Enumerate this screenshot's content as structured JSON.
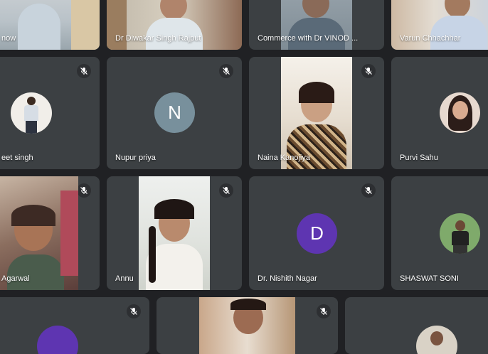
{
  "participants": [
    {
      "name": "now"
    },
    {
      "name": "Dr Diwakar Singh Rajput"
    },
    {
      "name": "Commerce with Dr VINOD ..."
    },
    {
      "name": "Varun Chhachhar"
    },
    {
      "name": "eet singh"
    },
    {
      "name": "Nupur priya",
      "avatar_letter": "N",
      "avatar_color": "#78909c"
    },
    {
      "name": "Naina Kanojiya"
    },
    {
      "name": "Purvi Sahu"
    },
    {
      "name": "Agarwal"
    },
    {
      "name": "Annu"
    },
    {
      "name": "Dr. Nishith Nagar",
      "avatar_letter": "D",
      "avatar_color": "#5e35b1"
    },
    {
      "name": "SHASWAT SONI"
    }
  ],
  "icons": {
    "mic_muted": "mic-off-icon"
  },
  "colors": {
    "background": "#202124",
    "tile": "#3c4043"
  }
}
